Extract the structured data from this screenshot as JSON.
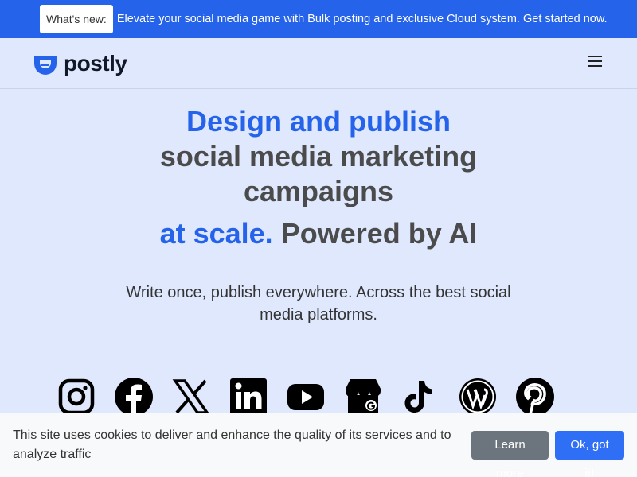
{
  "announcement": {
    "badge": "What's new:",
    "message": "Elevate your social media game with Bulk posting and exclusive Cloud system. Get started now."
  },
  "header": {
    "logo_text": "postly",
    "menu_icon": "hamburger-menu-icon"
  },
  "hero": {
    "line1": "Design and publish",
    "line2": "social media marketing",
    "line3": "campaigns",
    "line4_highlight": "at scale.",
    "line4_rest": " Powered by AI",
    "subtitle": "Write once, publish everywhere. Across the best social media platforms."
  },
  "socials": [
    {
      "icon": "instagram-icon"
    },
    {
      "icon": "facebook-icon"
    },
    {
      "icon": "x-twitter-icon"
    },
    {
      "icon": "linkedin-icon"
    },
    {
      "icon": "youtube-icon"
    },
    {
      "icon": "google-business-icon"
    },
    {
      "icon": "tiktok-icon"
    },
    {
      "icon": "wordpress-icon"
    },
    {
      "icon": "pinterest-icon"
    }
  ],
  "cookie_banner": {
    "text": "This site uses cookies to deliver and enhance the quality of its services and to analyze traffic",
    "learn_more": "Learn more",
    "accept": "Ok, got it!"
  },
  "colors": {
    "brand_blue": "#2563eb",
    "background": "#dfe8fd",
    "heading_grey": "#4b4b4b",
    "secondary_button": "#6c757d",
    "primary_button": "#2f6ff5"
  }
}
